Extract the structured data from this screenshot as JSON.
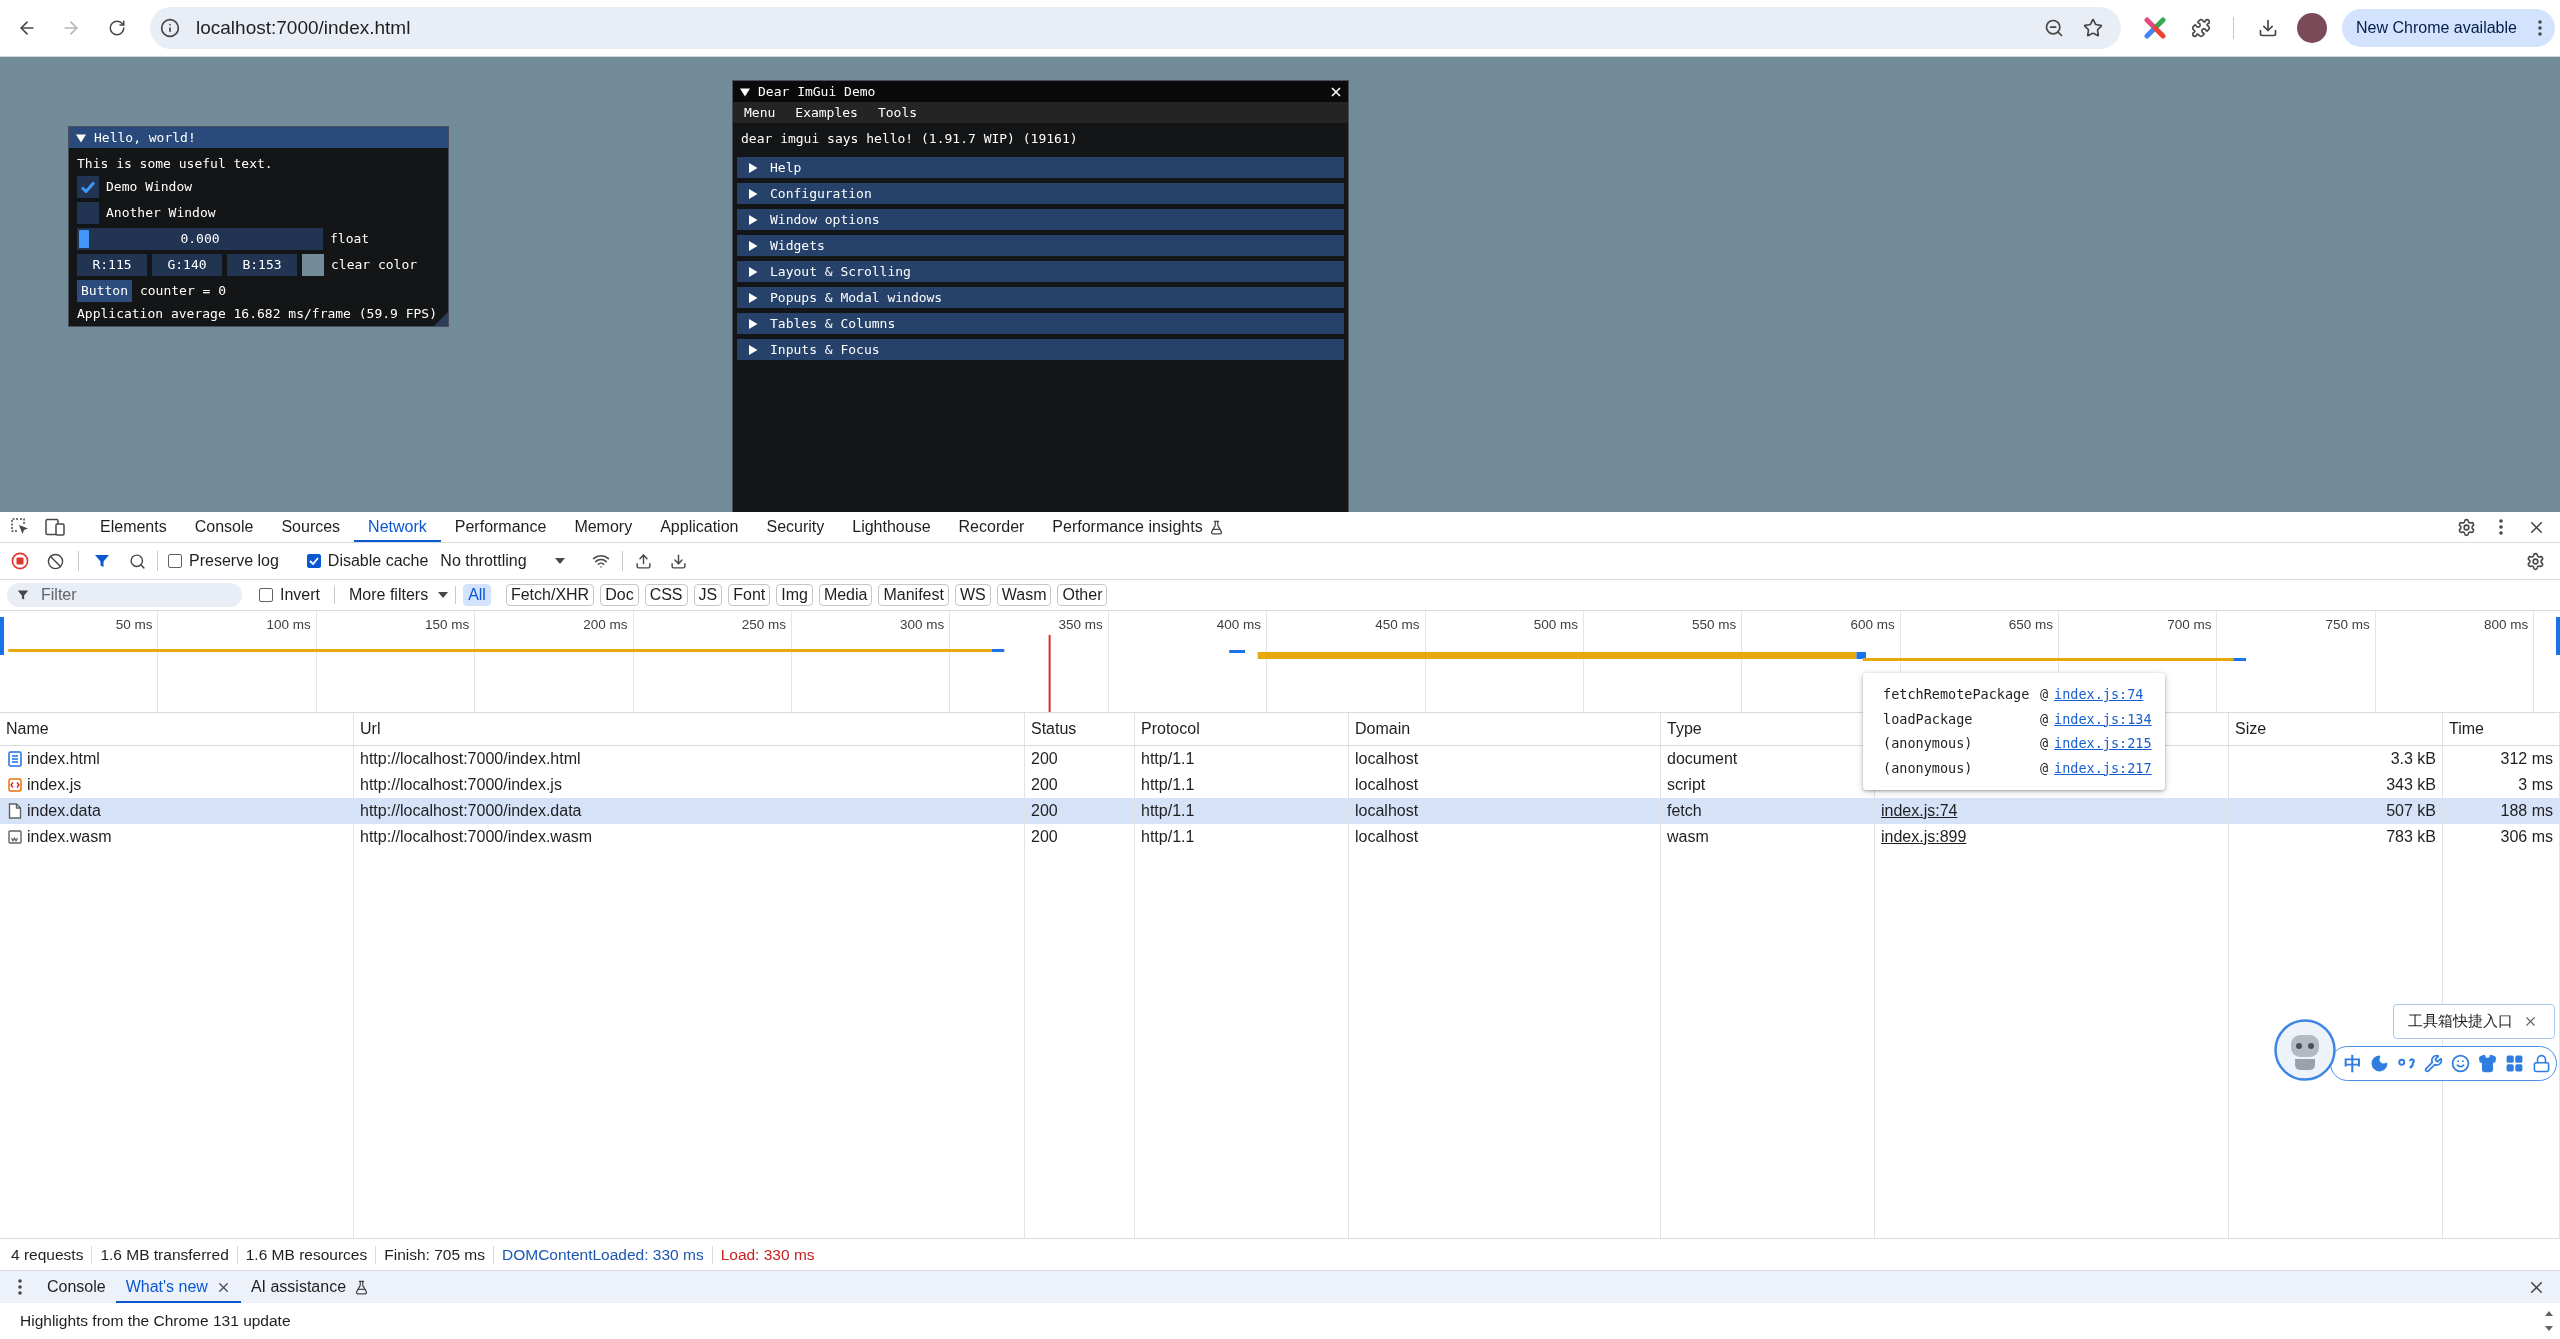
{
  "browser": {
    "back": {
      "disabled": false
    },
    "forward": {
      "disabled": true
    },
    "address": "localhost:7000/index.html",
    "update_button": "New Chrome available"
  },
  "page": {
    "hello_window": {
      "title": "Hello, world!",
      "collapsed": false,
      "focused": true,
      "text": "This is some useful text.",
      "checkboxes": [
        {
          "label": "Demo Window",
          "checked": true
        },
        {
          "label": "Another Window",
          "checked": false
        }
      ],
      "slider": {
        "value": "0.000",
        "level": 0,
        "label": "float"
      },
      "color_edit": {
        "channels": [
          "R:115",
          "G:140",
          "B:153"
        ],
        "color": "#738c99",
        "label": "clear color"
      },
      "button": "Button",
      "counter": "counter = 0",
      "stats": "Application average 16.682 ms/frame (59.9 FPS)"
    },
    "demo_window": {
      "title": "Dear ImGui Demo",
      "collapsed": false,
      "focused": false,
      "menu": [
        "Menu",
        "Examples",
        "Tools"
      ],
      "greeting": "dear imgui says hello! (1.91.7 WIP) (19161)",
      "sections": [
        {
          "label": "Help",
          "expanded": false
        },
        {
          "label": "Configuration",
          "expanded": false
        },
        {
          "label": "Window options",
          "expanded": false
        },
        {
          "label": "Widgets",
          "expanded": false
        },
        {
          "label": "Layout & Scrolling",
          "expanded": false
        },
        {
          "label": "Popups & Modal windows",
          "expanded": false
        },
        {
          "label": "Tables & Columns",
          "expanded": false
        },
        {
          "label": "Inputs & Focus",
          "expanded": false
        }
      ]
    }
  },
  "devtools": {
    "tabs": [
      {
        "label": "Elements",
        "selected": false,
        "experimental": false
      },
      {
        "label": "Console",
        "selected": false,
        "experimental": false
      },
      {
        "label": "Sources",
        "selected": false,
        "experimental": false
      },
      {
        "label": "Network",
        "selected": true,
        "experimental": false
      },
      {
        "label": "Performance",
        "selected": false,
        "experimental": false
      },
      {
        "label": "Memory",
        "selected": false,
        "experimental": false
      },
      {
        "label": "Application",
        "selected": false,
        "experimental": false
      },
      {
        "label": "Security",
        "selected": false,
        "experimental": false
      },
      {
        "label": "Lighthouse",
        "selected": false,
        "experimental": false
      },
      {
        "label": "Recorder",
        "selected": false,
        "experimental": false
      },
      {
        "label": "Performance insights",
        "selected": false,
        "experimental": true
      }
    ],
    "toolbar": {
      "recording": true,
      "options": [
        {
          "label": "Preserve log",
          "checked": false
        },
        {
          "label": "Disable cache",
          "checked": true
        }
      ],
      "throttling": "No throttling"
    },
    "filter_bar": {
      "placeholder": "Filter",
      "invert": {
        "label": "Invert",
        "checked": false
      },
      "more_filters": "More filters",
      "types": [
        {
          "label": "All",
          "selected": true
        },
        {
          "label": "Fetch/XHR",
          "selected": false
        },
        {
          "label": "Doc",
          "selected": false
        },
        {
          "label": "CSS",
          "selected": false
        },
        {
          "label": "JS",
          "selected": false
        },
        {
          "label": "Font",
          "selected": false
        },
        {
          "label": "Img",
          "selected": false
        },
        {
          "label": "Media",
          "selected": false
        },
        {
          "label": "Manifest",
          "selected": false
        },
        {
          "label": "WS",
          "selected": false
        },
        {
          "label": "Wasm",
          "selected": false
        },
        {
          "label": "Other",
          "selected": false
        }
      ]
    },
    "overview": {
      "ticks": [
        "50 ms",
        "100 ms",
        "150 ms",
        "200 ms",
        "250 ms",
        "300 ms",
        "350 ms",
        "400 ms",
        "450 ms",
        "500 ms",
        "550 ms",
        "600 ms",
        "650 ms",
        "700 ms",
        "750 ms",
        "800 ms"
      ]
    },
    "table": {
      "columns": [
        "Name",
        "Url",
        "Status",
        "Protocol",
        "Domain",
        "Type",
        "Size",
        "Time"
      ],
      "rows": [
        {
          "name": "index.html",
          "kind": "doc",
          "url": "http://localhost:7000/index.html",
          "status": "200",
          "protocol": "http/1.1",
          "domain": "localhost",
          "type": "document",
          "size": "3.3 kB",
          "time": "312 ms",
          "selected": false
        },
        {
          "name": "index.js",
          "kind": "script",
          "url": "http://localhost:7000/index.js",
          "status": "200",
          "protocol": "http/1.1",
          "domain": "localhost",
          "type": "script",
          "size": "343 kB",
          "time": "3 ms",
          "selected": false
        },
        {
          "name": "index.data",
          "kind": "data",
          "url": "http://localhost:7000/index.data",
          "status": "200",
          "protocol": "http/1.1",
          "domain": "localhost",
          "type": "fetch",
          "initiator": "index.js:74",
          "size": "507 kB",
          "time": "188 ms",
          "selected": true
        },
        {
          "name": "index.wasm",
          "kind": "wasm",
          "url": "http://localhost:7000/index.wasm",
          "status": "200",
          "protocol": "http/1.1",
          "domain": "localhost",
          "type": "wasm",
          "initiator": "index.js:899",
          "size": "783 kB",
          "time": "306 ms",
          "selected": false
        }
      ]
    },
    "initiator_popup": {
      "frames": [
        {
          "function": "fetchRemotePackage",
          "separator": "@",
          "location": "index.js:74"
        },
        {
          "function": "loadPackage",
          "separator": "@",
          "location": "index.js:134"
        },
        {
          "function": "(anonymous)",
          "separator": "@",
          "location": "index.js:215"
        },
        {
          "function": "(anonymous)",
          "separator": "@",
          "location": "index.js:217"
        }
      ]
    },
    "status_bar": [
      {
        "text": "4 requests",
        "kind": "plain"
      },
      {
        "text": "1.6 MB transferred",
        "kind": "plain"
      },
      {
        "text": "1.6 MB resources",
        "kind": "plain"
      },
      {
        "text": "Finish: 705 ms",
        "kind": "plain"
      },
      {
        "text": "DOMContentLoaded: 330 ms",
        "kind": "dom"
      },
      {
        "text": "Load: 330 ms",
        "kind": "load"
      }
    ],
    "drawer": {
      "tabs": [
        {
          "label": "Console",
          "selected": false,
          "closable": false,
          "experimental": false
        },
        {
          "label": "What's new",
          "selected": true,
          "closable": true,
          "experimental": false
        },
        {
          "label": "AI assistance",
          "selected": false,
          "closable": false,
          "experimental": true
        }
      ],
      "content": "Highlights from the Chrome 131 update"
    }
  },
  "ime_toolbar": {
    "tooltip": "工具箱快捷入口",
    "language": "中"
  }
}
